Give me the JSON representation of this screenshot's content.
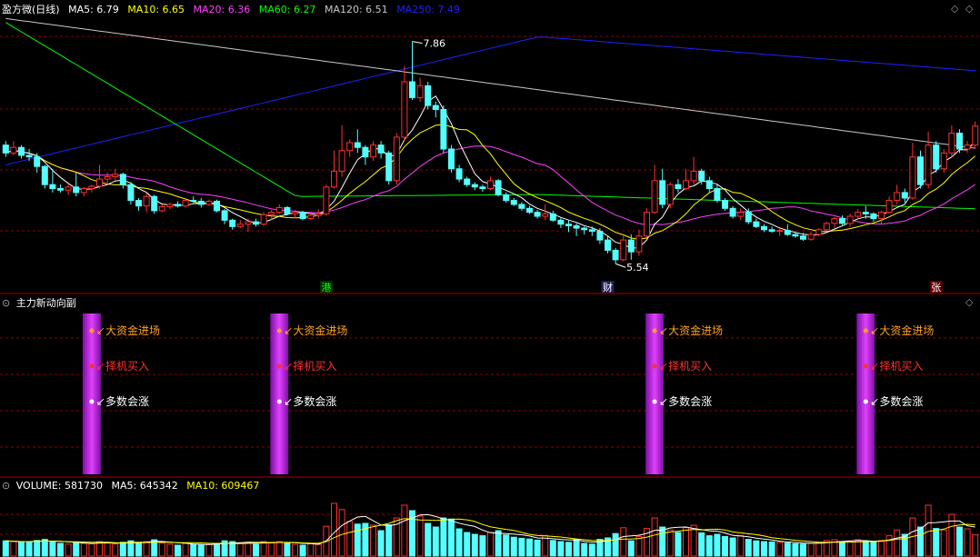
{
  "title": "盈方微(日线)",
  "ma_header": [
    {
      "label": "MA5: 6.79",
      "color": "#ffffff"
    },
    {
      "label": "MA10: 6.65",
      "color": "#ffff00"
    },
    {
      "label": "MA20: 6.36",
      "color": "#ff40ff"
    },
    {
      "label": "MA60: 6.27",
      "color": "#00ff00"
    },
    {
      "label": "MA120: 6.51",
      "color": "#c8c8c8"
    },
    {
      "label": "MA250: 7.49",
      "color": "#2020ff"
    }
  ],
  "ma_colors": {
    "ma5": "#ffffff",
    "ma10": "#ffff00",
    "ma20": "#ff40ff",
    "ma60": "#00ff00",
    "ma120": "#c8c8c8",
    "ma250": "#2020ff"
  },
  "colors": {
    "up": "#ff3030",
    "down": "#54ffff",
    "grid": "#8b0000",
    "axis": "#b00000"
  },
  "price_annotations": {
    "high": "7.86",
    "low": "5.54"
  },
  "event_markers": [
    {
      "label": "港",
      "candle": 41,
      "color": "#00ff00",
      "bg": "#003000"
    },
    {
      "label": "财",
      "candle": 77,
      "color": "#ffffff",
      "bg": "#202060"
    },
    {
      "label": "张",
      "candle": 119,
      "color": "#ffffff",
      "bg": "#600000"
    }
  ],
  "indicator": {
    "title": "主力新动向副",
    "signal_candles": [
      11,
      35,
      83,
      110
    ],
    "signal_labels": [
      {
        "text": "大资金进场",
        "color": "#ffa020"
      },
      {
        "text": "择机买入",
        "color": "#ff3030"
      },
      {
        "text": "多数会涨",
        "color": "#ffffff"
      }
    ]
  },
  "volume_header": [
    {
      "label": "VOLUME: 581730",
      "color": "#ffffff"
    },
    {
      "label": "MA5: 645342",
      "color": "#ffffff"
    },
    {
      "label": "MA10: 609467",
      "color": "#ffff00"
    }
  ],
  "chart_data": {
    "type": "candlestick",
    "title": "盈方微(日线)",
    "candles": [
      [
        6.55,
        6.6,
        6.4,
        6.45
      ],
      [
        6.45,
        6.6,
        6.42,
        6.52
      ],
      [
        6.52,
        6.55,
        6.38,
        6.42
      ],
      [
        6.42,
        6.5,
        6.35,
        6.4
      ],
      [
        6.4,
        6.45,
        6.2,
        6.28
      ],
      [
        6.28,
        6.3,
        6.0,
        6.05
      ],
      [
        6.05,
        6.25,
        5.95,
        6.0
      ],
      [
        6.0,
        6.05,
        5.95,
        5.98
      ],
      [
        5.98,
        6.05,
        5.92,
        6.02
      ],
      [
        6.02,
        6.2,
        5.9,
        5.95
      ],
      [
        5.95,
        6.02,
        5.9,
        6.0
      ],
      [
        6.0,
        6.05,
        5.95,
        6.03
      ],
      [
        6.03,
        6.3,
        6.0,
        6.12
      ],
      [
        6.12,
        6.2,
        6.05,
        6.15
      ],
      [
        6.15,
        6.25,
        6.1,
        6.18
      ],
      [
        6.18,
        6.2,
        6.0,
        6.05
      ],
      [
        6.05,
        6.08,
        5.8,
        5.85
      ],
      [
        5.85,
        5.88,
        5.72,
        5.78
      ],
      [
        5.78,
        5.95,
        5.7,
        5.9
      ],
      [
        5.9,
        5.92,
        5.68,
        5.72
      ],
      [
        5.72,
        5.8,
        5.7,
        5.77
      ],
      [
        5.77,
        5.82,
        5.74,
        5.8
      ],
      [
        5.8,
        5.84,
        5.76,
        5.78
      ],
      [
        5.78,
        5.88,
        5.76,
        5.85
      ],
      [
        5.85,
        5.9,
        5.82,
        5.84
      ],
      [
        5.84,
        5.88,
        5.76,
        5.8
      ],
      [
        5.8,
        5.86,
        5.78,
        5.84
      ],
      [
        5.84,
        5.86,
        5.7,
        5.72
      ],
      [
        5.72,
        5.74,
        5.55,
        5.6
      ],
      [
        5.6,
        5.62,
        5.48,
        5.52
      ],
      [
        5.52,
        5.6,
        5.5,
        5.55
      ],
      [
        5.55,
        5.62,
        5.45,
        5.58
      ],
      [
        5.58,
        5.62,
        5.52,
        5.55
      ],
      [
        5.55,
        5.7,
        5.53,
        5.67
      ],
      [
        5.67,
        5.73,
        5.6,
        5.7
      ],
      [
        5.7,
        5.8,
        5.68,
        5.76
      ],
      [
        5.76,
        5.78,
        5.66,
        5.68
      ],
      [
        5.68,
        5.73,
        5.62,
        5.7
      ],
      [
        5.7,
        5.72,
        5.6,
        5.62
      ],
      [
        5.62,
        5.7,
        5.6,
        5.66
      ],
      [
        5.66,
        5.74,
        5.62,
        5.68
      ],
      [
        5.68,
        6.05,
        5.66,
        6.02
      ],
      [
        6.02,
        6.48,
        6.0,
        6.22
      ],
      [
        6.22,
        6.8,
        6.15,
        6.48
      ],
      [
        6.48,
        6.62,
        6.4,
        6.58
      ],
      [
        6.58,
        6.75,
        6.45,
        6.52
      ],
      [
        6.52,
        6.55,
        6.3,
        6.4
      ],
      [
        6.4,
        6.6,
        6.35,
        6.55
      ],
      [
        6.55,
        6.6,
        6.38,
        6.45
      ],
      [
        6.45,
        6.48,
        6.05,
        6.1
      ],
      [
        6.1,
        6.7,
        6.05,
        6.65
      ],
      [
        6.65,
        7.55,
        6.6,
        7.35
      ],
      [
        7.35,
        7.86,
        7.12,
        7.15
      ],
      [
        7.15,
        7.4,
        7.1,
        7.3
      ],
      [
        7.3,
        7.35,
        7.0,
        7.05
      ],
      [
        7.05,
        7.1,
        6.9,
        7.0
      ],
      [
        7.0,
        7.05,
        6.45,
        6.5
      ],
      [
        6.5,
        6.55,
        6.2,
        6.25
      ],
      [
        6.25,
        6.3,
        6.08,
        6.12
      ],
      [
        6.12,
        6.15,
        6.02,
        6.05
      ],
      [
        6.05,
        6.08,
        5.98,
        6.02
      ],
      [
        6.02,
        6.05,
        5.96,
        6.0
      ],
      [
        6.0,
        6.15,
        5.98,
        6.1
      ],
      [
        6.1,
        6.12,
        5.9,
        5.92
      ],
      [
        5.92,
        5.95,
        5.82,
        5.85
      ],
      [
        5.85,
        5.88,
        5.78,
        5.8
      ],
      [
        5.8,
        5.83,
        5.72,
        5.75
      ],
      [
        5.75,
        5.78,
        5.68,
        5.7
      ],
      [
        5.7,
        5.73,
        5.62,
        5.65
      ],
      [
        5.65,
        5.8,
        5.6,
        5.68
      ],
      [
        5.68,
        5.72,
        5.58,
        5.6
      ],
      [
        5.6,
        5.63,
        5.5,
        5.55
      ],
      [
        5.55,
        5.6,
        5.45,
        5.53
      ],
      [
        5.53,
        5.56,
        5.4,
        5.5
      ],
      [
        5.5,
        5.52,
        5.42,
        5.48
      ],
      [
        5.48,
        5.52,
        5.4,
        5.46
      ],
      [
        5.46,
        5.5,
        5.3,
        5.35
      ],
      [
        5.35,
        5.4,
        5.18,
        5.22
      ],
      [
        5.22,
        5.25,
        5.05,
        5.1
      ],
      [
        5.1,
        5.4,
        5.08,
        5.35
      ],
      [
        5.35,
        5.42,
        5.1,
        5.2
      ],
      [
        5.2,
        5.48,
        5.15,
        5.4
      ],
      [
        5.4,
        5.75,
        5.38,
        5.7
      ],
      [
        5.7,
        6.3,
        5.68,
        6.1
      ],
      [
        6.1,
        6.25,
        5.75,
        5.8
      ],
      [
        5.8,
        6.08,
        5.75,
        6.05
      ],
      [
        6.05,
        6.12,
        5.95,
        6.0
      ],
      [
        6.0,
        6.25,
        5.98,
        6.1
      ],
      [
        6.1,
        6.4,
        6.05,
        6.22
      ],
      [
        6.22,
        6.25,
        6.05,
        6.1
      ],
      [
        6.1,
        6.15,
        5.95,
        6.0
      ],
      [
        6.0,
        6.05,
        5.82,
        5.85
      ],
      [
        5.85,
        5.88,
        5.72,
        5.75
      ],
      [
        5.75,
        5.78,
        5.62,
        5.65
      ],
      [
        5.65,
        5.75,
        5.6,
        5.7
      ],
      [
        5.7,
        5.75,
        5.55,
        5.58
      ],
      [
        5.58,
        5.62,
        5.5,
        5.52
      ],
      [
        5.52,
        5.55,
        5.45,
        5.48
      ],
      [
        5.48,
        5.52,
        5.44,
        5.46
      ],
      [
        5.46,
        5.5,
        5.4,
        5.47
      ],
      [
        5.47,
        5.55,
        5.4,
        5.42
      ],
      [
        5.42,
        5.46,
        5.38,
        5.4
      ],
      [
        5.4,
        5.44,
        5.34,
        5.36
      ],
      [
        5.36,
        5.46,
        5.34,
        5.42
      ],
      [
        5.42,
        5.5,
        5.4,
        5.48
      ],
      [
        5.48,
        5.58,
        5.46,
        5.56
      ],
      [
        5.56,
        5.64,
        5.5,
        5.62
      ],
      [
        5.62,
        5.66,
        5.54,
        5.56
      ],
      [
        5.56,
        5.68,
        5.52,
        5.65
      ],
      [
        5.65,
        5.74,
        5.6,
        5.7
      ],
      [
        5.7,
        5.78,
        5.62,
        5.68
      ],
      [
        5.68,
        5.7,
        5.58,
        5.62
      ],
      [
        5.62,
        5.72,
        5.56,
        5.7
      ],
      [
        5.7,
        5.9,
        5.68,
        5.85
      ],
      [
        5.85,
        6.05,
        5.8,
        5.95
      ],
      [
        5.95,
        6.0,
        5.82,
        5.88
      ],
      [
        5.88,
        6.58,
        5.86,
        6.4
      ],
      [
        6.4,
        6.48,
        6.0,
        6.05
      ],
      [
        6.05,
        6.72,
        6.0,
        6.55
      ],
      [
        6.55,
        6.6,
        6.2,
        6.25
      ],
      [
        6.25,
        6.5,
        6.2,
        6.45
      ],
      [
        6.45,
        6.8,
        6.4,
        6.7
      ],
      [
        6.7,
        6.75,
        6.45,
        6.5
      ],
      [
        6.5,
        6.6,
        6.45,
        6.55
      ],
      [
        6.55,
        6.85,
        6.5,
        6.79
      ]
    ],
    "volume": [
      420000,
      400000,
      380000,
      395000,
      430000,
      460000,
      400000,
      350000,
      330000,
      370000,
      350000,
      340000,
      400000,
      360000,
      330000,
      380000,
      420000,
      380000,
      400000,
      450000,
      360000,
      330000,
      300000,
      350000,
      320000,
      310000,
      320000,
      350000,
      420000,
      400000,
      360000,
      380000,
      330000,
      400000,
      380000,
      400000,
      350000,
      320000,
      300000,
      340000,
      320000,
      820000,
      1450000,
      1280000,
      950000,
      880000,
      900000,
      850000,
      700000,
      860000,
      1050000,
      1400000,
      1250000,
      1100000,
      900000,
      800000,
      1050000,
      1020000,
      750000,
      650000,
      600000,
      560000,
      650000,
      700000,
      580000,
      520000,
      490000,
      470000,
      440000,
      560000,
      430000,
      400000,
      380000,
      460000,
      350000,
      330000,
      460000,
      500000,
      620000,
      780000,
      420000,
      540000,
      760000,
      1050000,
      800000,
      720000,
      650000,
      780000,
      850000,
      640000,
      560000,
      600000,
      540000,
      500000,
      560000,
      460000,
      420000,
      400000,
      390000,
      380000,
      360000,
      340000,
      330000,
      350000,
      380000,
      430000,
      450000,
      400000,
      420000,
      450000,
      400000,
      380000,
      430000,
      560000,
      720000,
      600000,
      1050000,
      800000,
      1400000,
      760000,
      720000,
      1150000,
      800000,
      750000,
      581730
    ],
    "xlim": [
      0,
      125
    ],
    "ylim": [
      4.8,
      8.2
    ],
    "volume_ylim": [
      0,
      1600000
    ],
    "annotations": [
      {
        "text": "7.86",
        "candle": 52
      },
      {
        "text": "5.54",
        "candle": 78
      }
    ]
  }
}
